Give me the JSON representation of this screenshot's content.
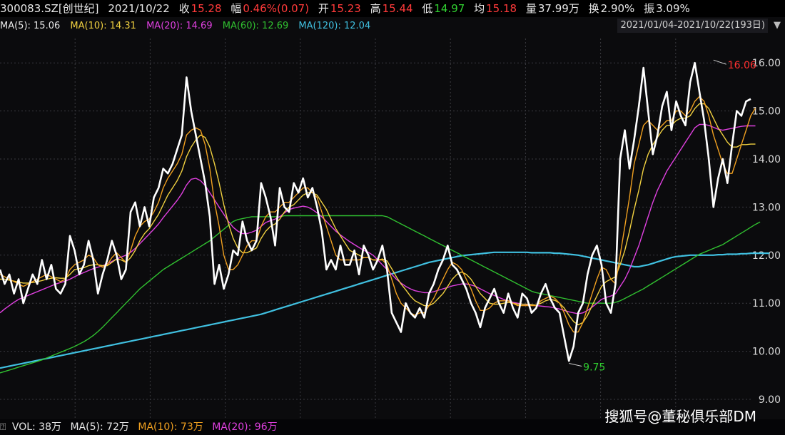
{
  "header": {
    "code": "300083.SZ[创世纪]",
    "date": "2021/10/22",
    "close_label": "收",
    "close": "15.28",
    "chg_label": "幅",
    "chg": "0.46%(0.07)",
    "open_label": "开",
    "open": "15.23",
    "high_label": "高",
    "high": "15.44",
    "low_label": "低",
    "low": "14.97",
    "avg_label": "均",
    "avg": "15.18",
    "amt_label": "量",
    "amt": "37.99万",
    "turn_label": "换",
    "turn": "2.90%",
    "amp_label": "振",
    "amp": "3.09%"
  },
  "ma_legend": [
    {
      "label": "MA(5): 15.06",
      "color": "#e8e8e8"
    },
    {
      "label": "MA(10): 14.31",
      "color": "#f0d040"
    },
    {
      "label": "MA(20): 14.69",
      "color": "#e040e0"
    },
    {
      "label": "MA(60): 12.69",
      "color": "#30c030"
    },
    {
      "label": "MA(120): 12.04",
      "color": "#40c0e0"
    }
  ],
  "date_range": "2021/01/04-2021/10/22(193日)",
  "volume_legend": {
    "vol": "VOL: 38万",
    "ma5": "MA(5): 72万",
    "ma10": "MA(10): 73万",
    "ma20": "MA(20): 96万"
  },
  "watermark": "搜狐号@董秘俱乐部DM",
  "chart_data": {
    "type": "line",
    "ylim": [
      9.0,
      16.3
    ],
    "yticks": [
      9.0,
      10.0,
      11.0,
      12.0,
      13.0,
      14.0,
      15.0,
      16.0
    ],
    "ytick_labels": [
      "9.00",
      "10.00",
      "11.00",
      "12.00",
      "13.00",
      "14.00",
      "15.00",
      "16.00"
    ],
    "annotations": [
      {
        "text": "16.06",
        "x": 153,
        "y": 16.06,
        "color": "#ff3030"
      },
      {
        "text": "9.75",
        "x": 122,
        "y": 9.75,
        "color": "#30d030"
      }
    ],
    "series": [
      {
        "key": "price",
        "color": "#ffffff",
        "width": 2.6,
        "values": [
          11.7,
          11.4,
          11.6,
          11.2,
          11.5,
          11.0,
          11.3,
          11.6,
          11.4,
          11.9,
          11.5,
          11.8,
          11.3,
          11.2,
          11.4,
          12.4,
          12.1,
          11.6,
          11.8,
          12.3,
          11.9,
          11.2,
          11.6,
          11.9,
          12.3,
          12.0,
          11.5,
          11.7,
          12.9,
          13.1,
          12.6,
          13.0,
          12.6,
          13.2,
          13.4,
          13.8,
          13.7,
          13.9,
          14.2,
          14.5,
          15.7,
          15.0,
          14.5,
          14.0,
          13.5,
          12.8,
          11.4,
          11.8,
          11.3,
          11.6,
          12.1,
          12.0,
          12.7,
          12.3,
          12.1,
          12.3,
          13.5,
          13.2,
          12.8,
          12.2,
          13.4,
          13.0,
          12.9,
          13.5,
          13.3,
          13.6,
          13.2,
          13.4,
          13.0,
          12.5,
          11.7,
          11.9,
          11.7,
          12.2,
          11.8,
          11.8,
          12.1,
          11.6,
          12.2,
          12.0,
          11.7,
          11.9,
          12.2,
          11.7,
          10.8,
          10.6,
          10.4,
          11.0,
          10.8,
          10.7,
          10.9,
          10.7,
          11.2,
          11.4,
          11.7,
          11.9,
          12.2,
          11.8,
          11.7,
          11.5,
          11.3,
          11.0,
          10.8,
          10.5,
          10.9,
          11.1,
          11.3,
          11.0,
          10.8,
          11.2,
          10.9,
          10.7,
          11.2,
          11.1,
          10.8,
          10.9,
          11.2,
          11.4,
          11.1,
          10.9,
          10.8,
          10.3,
          9.8,
          10.1,
          10.8,
          11.0,
          11.6,
          12.0,
          12.2,
          11.8,
          11.0,
          10.8,
          11.4,
          14.0,
          14.6,
          13.8,
          14.4,
          15.1,
          15.9,
          15.0,
          14.1,
          14.5,
          15.1,
          15.4,
          14.6,
          15.2,
          14.9,
          14.7,
          15.6,
          16.0,
          15.4,
          14.8,
          14.0,
          13.0,
          13.6,
          14.0,
          13.5,
          14.3,
          15.0,
          14.9,
          15.2,
          15.25
        ]
      },
      {
        "key": "ma5",
        "color": "#f0a020",
        "width": 1.4,
        "values": [
          11.6,
          11.55,
          11.5,
          11.45,
          11.4,
          11.35,
          11.4,
          11.45,
          11.5,
          11.55,
          11.6,
          11.55,
          11.5,
          11.45,
          11.5,
          11.7,
          11.8,
          11.85,
          11.9,
          12.0,
          11.95,
          11.8,
          11.75,
          11.8,
          11.95,
          12.05,
          11.95,
          11.85,
          12.1,
          12.4,
          12.6,
          12.7,
          12.75,
          12.9,
          13.1,
          13.4,
          13.6,
          13.75,
          13.9,
          14.1,
          14.5,
          14.6,
          14.65,
          14.6,
          14.3,
          13.8,
          13.1,
          12.6,
          12.0,
          11.7,
          11.7,
          11.8,
          12.0,
          12.2,
          12.3,
          12.3,
          12.6,
          12.8,
          12.9,
          12.9,
          13.0,
          13.1,
          13.1,
          13.2,
          13.3,
          13.4,
          13.4,
          13.3,
          13.2,
          12.9,
          12.6,
          12.3,
          12.0,
          11.9,
          11.9,
          11.9,
          11.9,
          11.9,
          11.95,
          11.95,
          11.9,
          11.9,
          11.9,
          11.8,
          11.5,
          11.2,
          11.0,
          10.9,
          10.8,
          10.75,
          10.8,
          10.8,
          10.95,
          11.1,
          11.3,
          11.5,
          11.7,
          11.85,
          11.8,
          11.7,
          11.5,
          11.3,
          11.05,
          10.85,
          10.85,
          10.9,
          11.0,
          11.05,
          11.05,
          11.05,
          11.0,
          10.95,
          10.95,
          10.95,
          10.95,
          10.95,
          11.05,
          11.1,
          11.15,
          11.1,
          11.0,
          10.8,
          10.55,
          10.4,
          10.4,
          10.6,
          10.9,
          11.2,
          11.5,
          11.75,
          11.7,
          11.5,
          11.4,
          12.0,
          12.6,
          13.2,
          13.9,
          14.3,
          14.7,
          14.8,
          14.7,
          14.6,
          14.7,
          14.8,
          14.8,
          15.0,
          15.0,
          14.9,
          15.0,
          15.2,
          15.3,
          15.2,
          14.9,
          14.5,
          14.2,
          13.9,
          13.7,
          13.7,
          14.0,
          14.3,
          14.6,
          14.9,
          15.06
        ]
      },
      {
        "key": "ma10",
        "color": "#f0d040",
        "width": 1.4,
        "values": [
          11.5,
          11.5,
          11.48,
          11.46,
          11.44,
          11.42,
          11.42,
          11.43,
          11.45,
          11.47,
          11.5,
          11.52,
          11.53,
          11.52,
          11.52,
          11.6,
          11.7,
          11.72,
          11.74,
          11.78,
          11.8,
          11.8,
          11.78,
          11.78,
          11.85,
          11.92,
          11.9,
          11.85,
          11.95,
          12.1,
          12.3,
          12.45,
          12.55,
          12.7,
          12.85,
          13.05,
          13.25,
          13.4,
          13.55,
          13.75,
          14.05,
          14.25,
          14.4,
          14.5,
          14.45,
          14.25,
          13.9,
          13.5,
          13.05,
          12.65,
          12.35,
          12.15,
          12.05,
          12.05,
          12.1,
          12.15,
          12.35,
          12.5,
          12.6,
          12.65,
          12.75,
          12.9,
          13.0,
          13.05,
          13.15,
          13.25,
          13.3,
          13.3,
          13.25,
          13.1,
          12.95,
          12.75,
          12.55,
          12.4,
          12.25,
          12.1,
          12.05,
          12.0,
          11.95,
          11.95,
          11.9,
          11.9,
          11.92,
          11.88,
          11.72,
          11.55,
          11.4,
          11.28,
          11.15,
          11.05,
          11.0,
          10.95,
          10.95,
          11.0,
          11.1,
          11.2,
          11.35,
          11.5,
          11.6,
          11.65,
          11.6,
          11.5,
          11.35,
          11.2,
          11.1,
          11.0,
          10.98,
          10.98,
          11.0,
          11.02,
          11.0,
          10.98,
          10.98,
          10.98,
          10.97,
          10.96,
          11.0,
          11.05,
          11.08,
          11.06,
          11.0,
          10.9,
          10.75,
          10.62,
          10.55,
          10.6,
          10.75,
          10.95,
          11.15,
          11.35,
          11.45,
          11.5,
          11.55,
          11.8,
          12.1,
          12.5,
          12.95,
          13.35,
          13.8,
          14.1,
          14.3,
          14.45,
          14.6,
          14.7,
          14.7,
          14.8,
          14.85,
          14.85,
          14.9,
          15.05,
          15.15,
          15.15,
          15.05,
          14.85,
          14.65,
          14.5,
          14.35,
          14.25,
          14.25,
          14.3,
          14.3,
          14.31,
          14.31
        ]
      },
      {
        "key": "ma20",
        "color": "#e040e0",
        "width": 1.4,
        "values": [
          10.8,
          10.88,
          10.95,
          11.02,
          11.08,
          11.12,
          11.16,
          11.2,
          11.24,
          11.28,
          11.32,
          11.36,
          11.4,
          11.43,
          11.46,
          11.5,
          11.55,
          11.6,
          11.64,
          11.68,
          11.72,
          11.75,
          11.78,
          11.82,
          11.87,
          11.92,
          11.96,
          12.0,
          12.06,
          12.14,
          12.24,
          12.34,
          12.44,
          12.54,
          12.65,
          12.78,
          12.9,
          13.02,
          13.14,
          13.28,
          13.46,
          13.58,
          13.6,
          13.55,
          13.45,
          13.3,
          13.15,
          13.0,
          12.85,
          12.7,
          12.58,
          12.5,
          12.45,
          12.45,
          12.48,
          12.52,
          12.6,
          12.68,
          12.72,
          12.75,
          12.8,
          12.88,
          12.95,
          12.98,
          13.0,
          13.02,
          13.0,
          12.95,
          12.88,
          12.8,
          12.7,
          12.6,
          12.5,
          12.42,
          12.35,
          12.28,
          12.22,
          12.16,
          12.1,
          12.06,
          12.0,
          11.9,
          11.8,
          11.7,
          11.6,
          11.5,
          11.42,
          11.35,
          11.3,
          11.26,
          11.24,
          11.22,
          11.22,
          11.24,
          11.27,
          11.3,
          11.33,
          11.36,
          11.38,
          11.4,
          11.4,
          11.38,
          11.35,
          11.3,
          11.25,
          11.2,
          11.16,
          11.12,
          11.08,
          11.05,
          11.02,
          11.0,
          10.98,
          10.97,
          10.96,
          10.95,
          10.94,
          10.93,
          10.92,
          10.9,
          10.88,
          10.85,
          10.82,
          10.8,
          10.78,
          10.8,
          10.85,
          10.92,
          11.0,
          11.08,
          11.12,
          11.15,
          11.2,
          11.35,
          11.5,
          11.7,
          11.95,
          12.2,
          12.5,
          12.8,
          13.1,
          13.35,
          13.55,
          13.75,
          13.9,
          14.05,
          14.2,
          14.35,
          14.5,
          14.65,
          14.72,
          14.72,
          14.7,
          14.66,
          14.62,
          14.6,
          14.62,
          14.64,
          14.66,
          14.68,
          14.69,
          14.69,
          14.69
        ]
      },
      {
        "key": "ma60",
        "color": "#30c030",
        "width": 1.4,
        "values": [
          9.55,
          9.58,
          9.61,
          9.64,
          9.67,
          9.7,
          9.73,
          9.76,
          9.79,
          9.82,
          9.86,
          9.9,
          9.94,
          9.98,
          10.02,
          10.06,
          10.1,
          10.15,
          10.2,
          10.26,
          10.33,
          10.41,
          10.5,
          10.6,
          10.7,
          10.8,
          10.9,
          11.0,
          11.1,
          11.2,
          11.3,
          11.38,
          11.46,
          11.54,
          11.62,
          11.7,
          11.76,
          11.82,
          11.88,
          11.94,
          12.0,
          12.06,
          12.12,
          12.18,
          12.24,
          12.3,
          12.38,
          12.46,
          12.54,
          12.62,
          12.7,
          12.74,
          12.76,
          12.78,
          12.8,
          12.8,
          12.8,
          12.8,
          12.8,
          12.8,
          12.8,
          12.82,
          12.82,
          12.82,
          12.82,
          12.82,
          12.82,
          12.82,
          12.82,
          12.82,
          12.82,
          12.82,
          12.82,
          12.82,
          12.82,
          12.82,
          12.82,
          12.82,
          12.82,
          12.82,
          12.82,
          12.82,
          12.82,
          12.8,
          12.75,
          12.7,
          12.65,
          12.6,
          12.55,
          12.5,
          12.45,
          12.4,
          12.35,
          12.3,
          12.25,
          12.2,
          12.15,
          12.1,
          12.05,
          12.0,
          11.95,
          11.9,
          11.85,
          11.8,
          11.75,
          11.7,
          11.65,
          11.6,
          11.55,
          11.5,
          11.45,
          11.4,
          11.35,
          11.3,
          11.25,
          11.22,
          11.2,
          11.18,
          11.16,
          11.14,
          11.12,
          11.1,
          11.08,
          11.06,
          11.04,
          11.02,
          11.0,
          11.0,
          11.0,
          11.0,
          11.0,
          11.0,
          11.02,
          11.05,
          11.1,
          11.15,
          11.2,
          11.25,
          11.3,
          11.36,
          11.42,
          11.48,
          11.54,
          11.6,
          11.66,
          11.72,
          11.78,
          11.84,
          11.9,
          11.96,
          12.02,
          12.06,
          12.1,
          12.14,
          12.18,
          12.22,
          12.28,
          12.34,
          12.4,
          12.46,
          12.52,
          12.58,
          12.64,
          12.69
        ]
      },
      {
        "key": "ma120",
        "color": "#40c0e0",
        "width": 2.2,
        "values": [
          9.65,
          9.67,
          9.69,
          9.71,
          9.73,
          9.75,
          9.77,
          9.79,
          9.81,
          9.83,
          9.85,
          9.87,
          9.89,
          9.91,
          9.93,
          9.95,
          9.97,
          9.99,
          10.01,
          10.03,
          10.05,
          10.07,
          10.09,
          10.11,
          10.13,
          10.15,
          10.17,
          10.19,
          10.21,
          10.23,
          10.25,
          10.27,
          10.29,
          10.31,
          10.33,
          10.35,
          10.37,
          10.39,
          10.41,
          10.43,
          10.45,
          10.47,
          10.49,
          10.51,
          10.53,
          10.55,
          10.57,
          10.59,
          10.61,
          10.63,
          10.65,
          10.67,
          10.69,
          10.71,
          10.73,
          10.75,
          10.77,
          10.8,
          10.83,
          10.86,
          10.89,
          10.92,
          10.95,
          10.98,
          11.01,
          11.04,
          11.07,
          11.1,
          11.13,
          11.16,
          11.19,
          11.22,
          11.25,
          11.28,
          11.31,
          11.34,
          11.37,
          11.4,
          11.43,
          11.46,
          11.49,
          11.52,
          11.55,
          11.58,
          11.61,
          11.64,
          11.67,
          11.7,
          11.73,
          11.76,
          11.79,
          11.82,
          11.85,
          11.87,
          11.89,
          11.91,
          11.93,
          11.95,
          11.97,
          11.99,
          12.0,
          12.01,
          12.02,
          12.03,
          12.04,
          12.05,
          12.06,
          12.06,
          12.06,
          12.06,
          12.06,
          12.06,
          12.06,
          12.06,
          12.05,
          12.05,
          12.05,
          12.05,
          12.05,
          12.04,
          12.04,
          12.03,
          12.02,
          12.01,
          12.0,
          11.98,
          11.96,
          11.94,
          11.92,
          11.9,
          11.88,
          11.86,
          11.84,
          11.82,
          11.8,
          11.78,
          11.76,
          11.76,
          11.78,
          11.8,
          11.83,
          11.86,
          11.89,
          11.92,
          11.95,
          11.97,
          11.98,
          11.99,
          12.0,
          12.0,
          12.0,
          12.0,
          12.0,
          12.0,
          12.01,
          12.01,
          12.02,
          12.02,
          12.02,
          12.03,
          12.03,
          12.04,
          12.04,
          12.04,
          12.04,
          12.04
        ]
      }
    ]
  }
}
